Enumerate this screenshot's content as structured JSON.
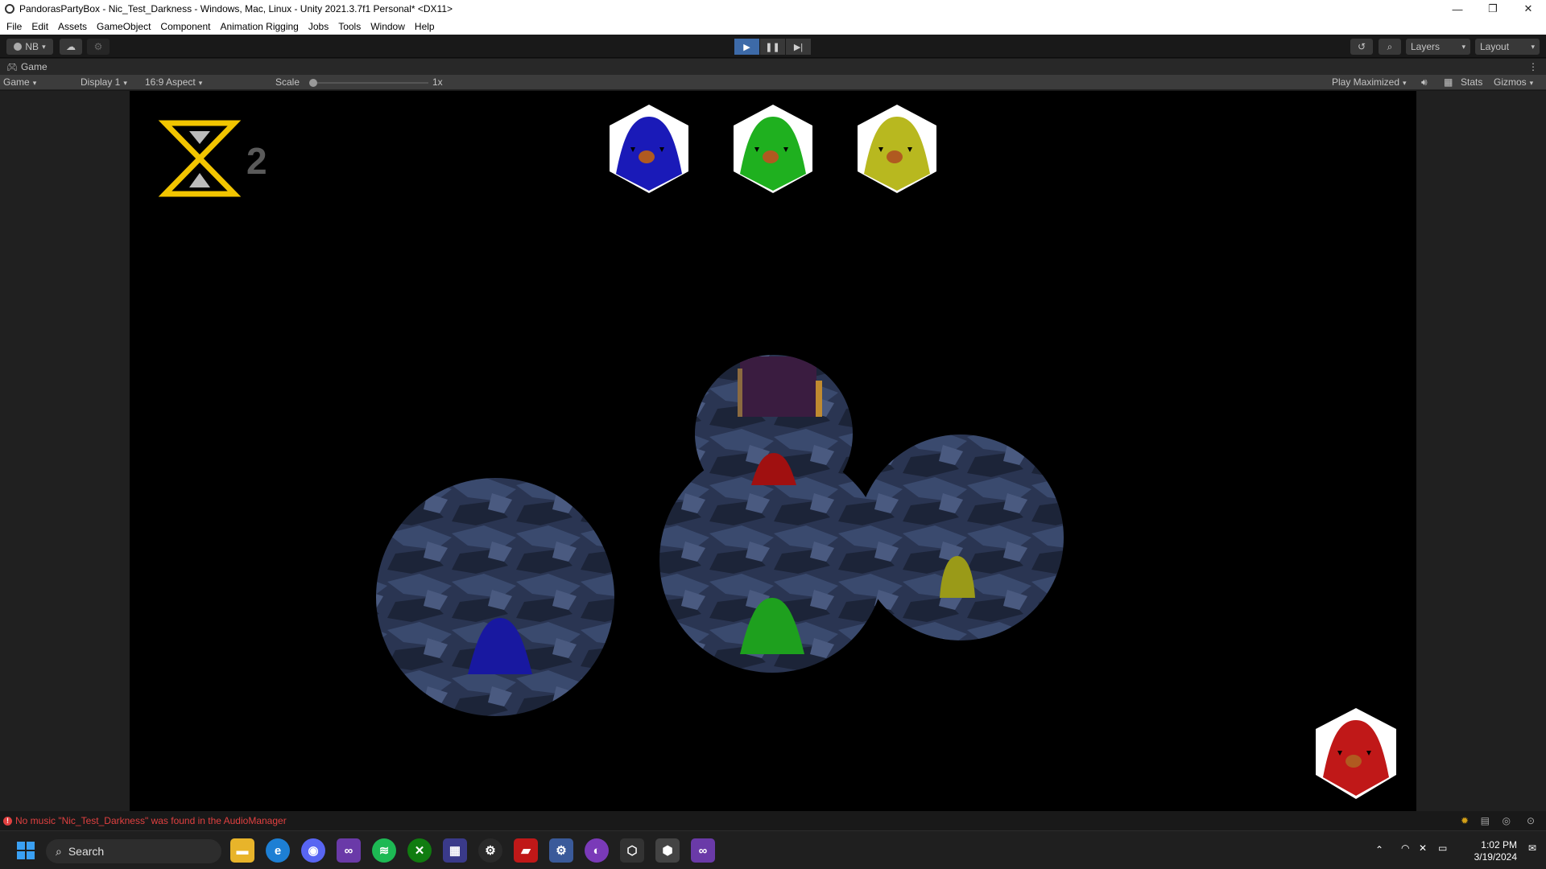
{
  "window": {
    "title": "PandorasPartyBox - Nic_Test_Darkness - Windows, Mac, Linux - Unity 2021.3.7f1 Personal* <DX11>",
    "controls": [
      "—",
      "❐",
      "✕"
    ]
  },
  "menu": [
    "File",
    "Edit",
    "Assets",
    "GameObject",
    "Component",
    "Animation Rigging",
    "Jobs",
    "Tools",
    "Window",
    "Help"
  ],
  "toolbar": {
    "account": "NB",
    "layers": "Layers",
    "layout": "Layout",
    "play_state": "playing"
  },
  "game_tab": {
    "label": "Game"
  },
  "game_bar": {
    "view": "Game",
    "display": "Display 1",
    "aspect": "16:9 Aspect",
    "scale_label": "Scale",
    "scale_value": "1x",
    "play_mode": "Play Maximized",
    "stats": "Stats",
    "gizmos": "Gizmos"
  },
  "game": {
    "timer_count": "2",
    "players_top": [
      {
        "color": "#1a1ab8",
        "icon": "bird-icon"
      },
      {
        "color": "#1fb01f",
        "icon": "bird-icon"
      },
      {
        "color": "#b8b81f",
        "icon": "bird-icon"
      }
    ],
    "player_corner": {
      "color": "#c01818",
      "icon": "bird-icon"
    },
    "colors": {
      "timer": "#f2c500",
      "cave": "#2c3a5c"
    }
  },
  "status": {
    "error_message": "No music \"Nic_Test_Darkness\" was found in the AudioManager"
  },
  "taskbar": {
    "search_placeholder": "Search",
    "time": "1:02 PM",
    "date": "3/19/2024",
    "apps": [
      "start-icon",
      "file-explorer-icon",
      "edge-icon",
      "discord-icon",
      "visual-studio-icon",
      "spotify-icon",
      "xbox-icon",
      "store-icon",
      "steam-icon",
      "app-icon",
      "settings-icon",
      "github-icon",
      "unity-hub-icon",
      "unity-icon",
      "visual-studio-icon"
    ]
  }
}
